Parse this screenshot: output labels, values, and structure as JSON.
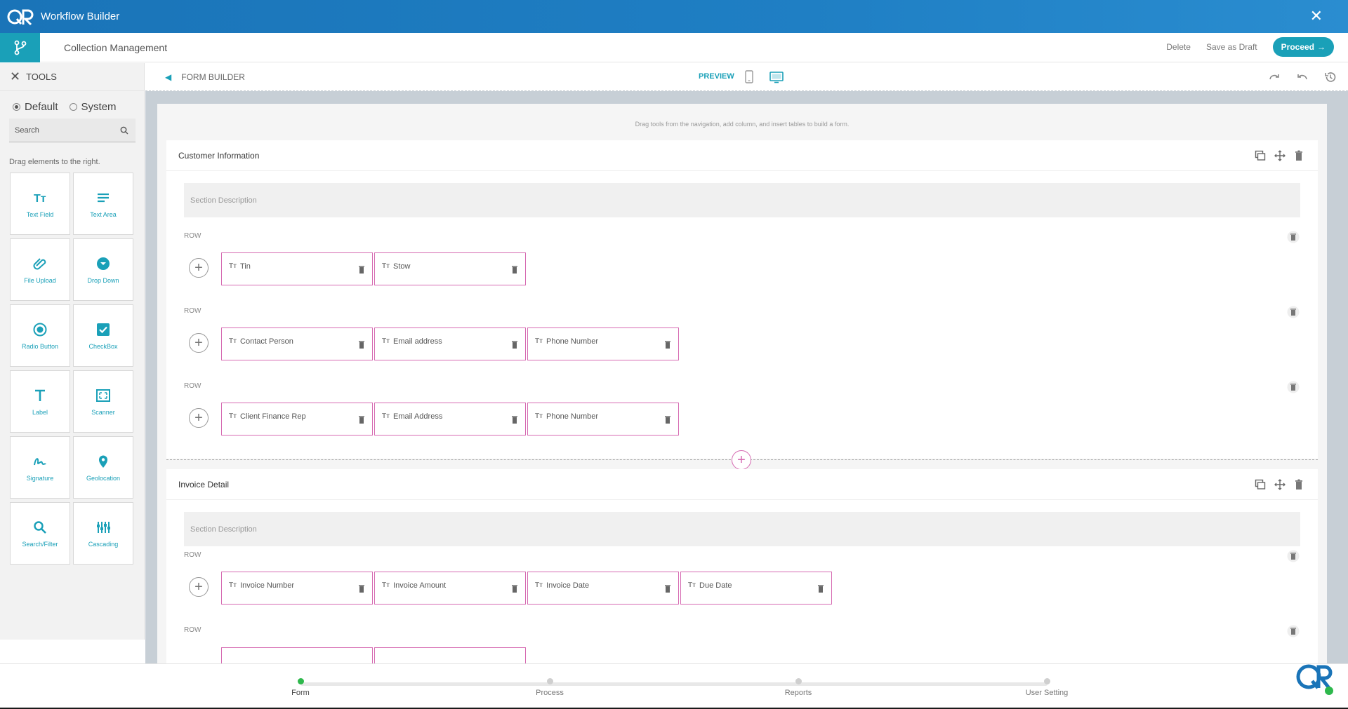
{
  "app": {
    "title": "Workflow Builder",
    "close_icon": "close-icon"
  },
  "subbar": {
    "breadcrumb": "Collection Management",
    "delete_label": "Delete",
    "draft_label": "Save as Draft",
    "proceed_label": "Proceed",
    "accent": "#1aa0b8"
  },
  "sidebar": {
    "header": "TOOLS",
    "radio_default": "Default",
    "radio_system": "System",
    "selected_mode": "Default",
    "search_placeholder": "Search",
    "hint": "Drag elements to the right.",
    "tools": [
      {
        "label": "Text Field",
        "icon": "text-field-icon"
      },
      {
        "label": "Text Area",
        "icon": "text-area-icon"
      },
      {
        "label": "File Upload",
        "icon": "paperclip-icon"
      },
      {
        "label": "Drop Down",
        "icon": "dropdown-icon"
      },
      {
        "label": "Radio Button",
        "icon": "radio-button-icon"
      },
      {
        "label": "CheckBox",
        "icon": "checkbox-icon"
      },
      {
        "label": "Label",
        "icon": "label-icon"
      },
      {
        "label": "Scanner",
        "icon": "scanner-icon"
      },
      {
        "label": "Signature",
        "icon": "signature-icon"
      },
      {
        "label": "Geolocation",
        "icon": "location-pin-icon"
      },
      {
        "label": "Search/Filter",
        "icon": "search-icon"
      },
      {
        "label": "Cascading",
        "icon": "cascading-icon"
      }
    ]
  },
  "builder": {
    "title": "FORM BUILDER",
    "preview_label": "PREVIEW",
    "drag_hint": "Drag tools from the navigation, add column, and insert tables to build a form.",
    "row_label": "ROW",
    "sections": [
      {
        "title": "Customer Information",
        "description_placeholder": "Section Description",
        "rows": [
          [
            "Tin",
            "Stow"
          ],
          [
            "Contact Person",
            "Email address",
            "Phone Number"
          ],
          [
            "Client Finance Rep",
            "Email Address",
            "Phone Number"
          ]
        ]
      },
      {
        "title": "Invoice Detail",
        "description_placeholder": "Section Description",
        "rows": [
          [
            "Invoice Number",
            "Invoice Amount",
            "Invoice Date",
            "Due Date"
          ]
        ]
      }
    ],
    "field_prefix": "Tт",
    "field_border_color": "#d66bb2"
  },
  "stepper": {
    "steps": [
      "Form",
      "Process",
      "Reports",
      "User Setting"
    ],
    "active": "Form",
    "active_color": "#2eb84c"
  }
}
